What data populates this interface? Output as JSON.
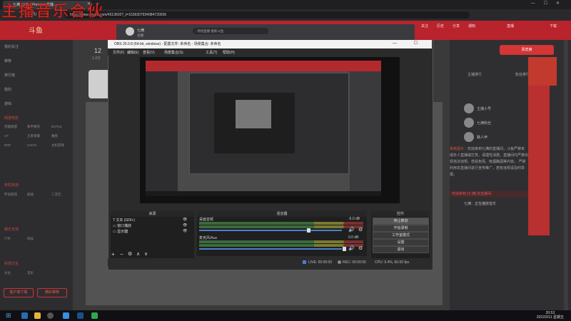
{
  "overlay_title": "主播音乐合伙",
  "browser": {
    "tab_title": "七满_斗鱼 | Premium直播...",
    "url": "https://www.douyu.com/4513602?_t=1536307934984720036",
    "search_placeholder": "寻找直播 搜索斗鱼"
  },
  "site": {
    "logo": "斗鱼",
    "header_items": [
      "关注",
      "历史",
      "分享",
      "通知",
      "直播",
      "下载"
    ],
    "room_count": "12",
    "room_sub": "1.3万"
  },
  "sidebar": {
    "items": [
      "我的关注",
      "推荐",
      "排行榜",
      "我的",
      "游戏"
    ],
    "sections": [
      "网游竞技",
      "单机热游",
      "娱乐天地",
      "科技文化"
    ],
    "grid_items": [
      "英雄联盟",
      "和平精英",
      "DOTA2",
      "CF",
      "王者荣耀",
      "魔兽",
      "DNF",
      "CSGO",
      "主机游戏",
      "怀旧游戏",
      "颜值",
      "二次元",
      "户外",
      "科技",
      "文化",
      "音乐"
    ],
    "bottom_buttons": [
      "客户端下载",
      "精彩推荐"
    ]
  },
  "obs": {
    "title": "OBS 25.0.8 (64-bit, windows) - 配置文件: 未命名 - 场景集合: 未命名",
    "menu": [
      "文件(F)",
      "编辑(E)",
      "查看(V)",
      "场景集合(S)",
      "工具(T)",
      "帮助(H)"
    ],
    "docks": {
      "sources": "来源",
      "mixer": "混音器",
      "controls": "控件"
    },
    "sources": [
      "文本 (GDI+)",
      "窗口捕获",
      "显示器"
    ],
    "mixer_channels": [
      {
        "label": "桌面音频",
        "db": "-6.0 dB"
      },
      {
        "label": "麦克风/Aux",
        "db": "0.0 dB"
      }
    ],
    "controls": [
      "停止推流",
      "开始录制",
      "工作室模式",
      "设置",
      "退出"
    ],
    "status": {
      "live": "LIVE: 00:00:00",
      "rec": "REC: 00:00:00",
      "cpu": "CPU: 9.4%, 60.00 fps"
    },
    "window_controls": "—  ☐  ✕",
    "obs_user": "七满",
    "obs_badge": "主播"
  },
  "right_panel": {
    "title_button": "贵宾席",
    "tabs": [
      "主播排行",
      "粉丝排行",
      "贵宾"
    ],
    "fans": [
      "主播小号",
      "七满粉丝",
      "路人甲"
    ],
    "chat": [
      {
        "nick": "系统提示：",
        "text": "欢迎来到七满的直播间，斗鱼严禁未成年人直播或打赏，请理性消费。直播间内严禁出现违法违规、低俗色情、吸烟酗酒等内容。"
      },
      {
        "nick": "",
        "text": "严禁利用本直播间进行宣传推广，若有违规请及时举报。"
      }
    ],
    "highlight": "欢迎来到 [七满] 的直播间",
    "chat_line2": "七满：正在播放音乐"
  },
  "taskbar": {
    "time": "20:53",
    "date": "2022/2/11 星期五"
  },
  "colors": {
    "accent": "#b8232c",
    "obs_blue": "#4a7fd0"
  }
}
